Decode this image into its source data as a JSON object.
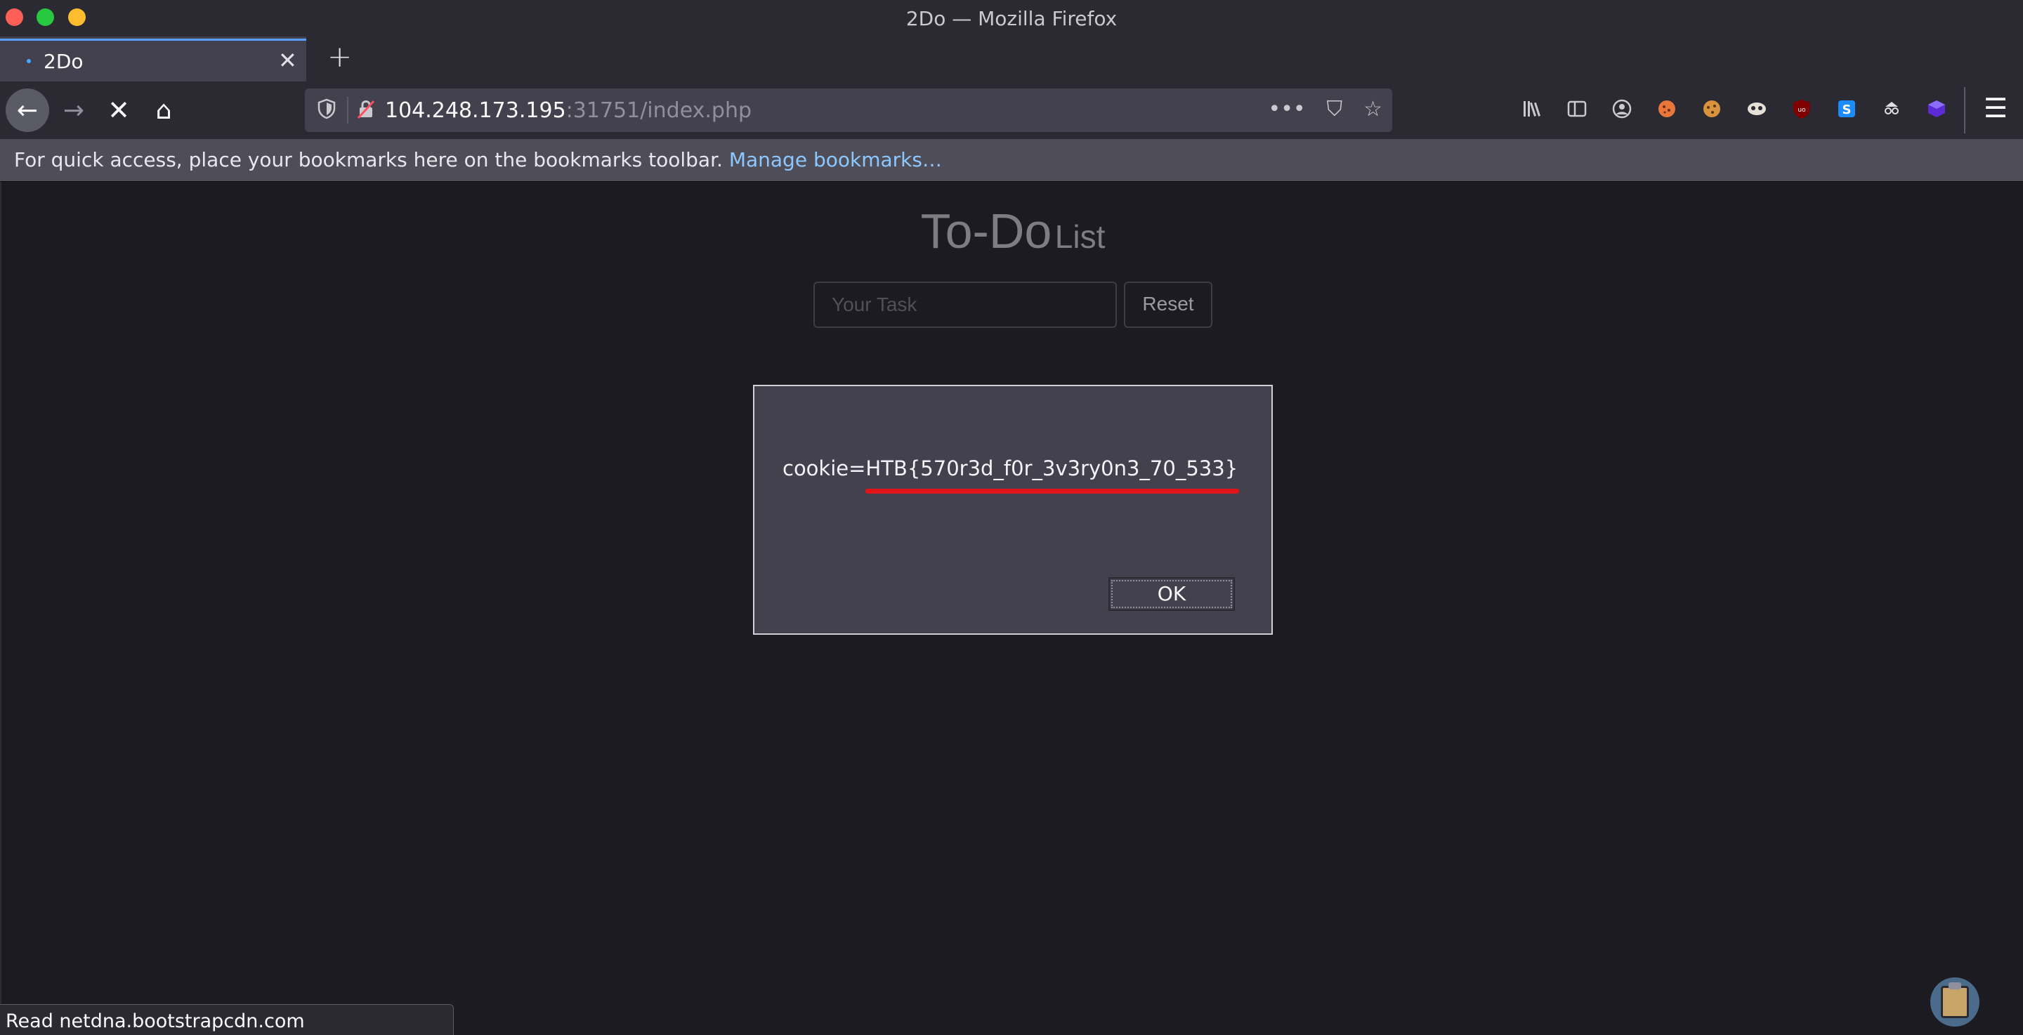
{
  "window": {
    "title": "2Do — Mozilla Firefox"
  },
  "tab": {
    "label": "2Do",
    "close_glyph": "✕",
    "new_tab_glyph": "+"
  },
  "navbar": {
    "back_glyph": "←",
    "forward_glyph": "→",
    "stop_glyph": "✕",
    "home_glyph": "⌂",
    "url_host": "104.248.173.195",
    "url_rest": ":31751/index.php",
    "page_actions": {
      "more": "•••",
      "pocket": "⛉",
      "star": "☆"
    },
    "extensions": [
      "library-icon",
      "sidebar-icon",
      "account-icon",
      "ext-cookie-icon",
      "ext-cookie2-icon",
      "ext-mask-icon",
      "ublock-icon",
      "ext-s-icon",
      "ext-spy-icon",
      "ext-cube-icon"
    ],
    "menu_glyph": "☰"
  },
  "bookmarks": {
    "hint": "For quick access, place your bookmarks here on the bookmarks toolbar.",
    "manage_link": "Manage bookmarks…"
  },
  "page": {
    "title_main": "To-Do",
    "title_sub": "List",
    "task_placeholder": "Your Task",
    "reset_label": "Reset"
  },
  "dialog": {
    "message": "cookie=HTB{570r3d_f0r_3v3ry0n3_70_533}",
    "ok_label": "OK",
    "highlight_color": "#e0121a"
  },
  "status": {
    "text": "Read netdna.bootstrapcdn.com"
  }
}
